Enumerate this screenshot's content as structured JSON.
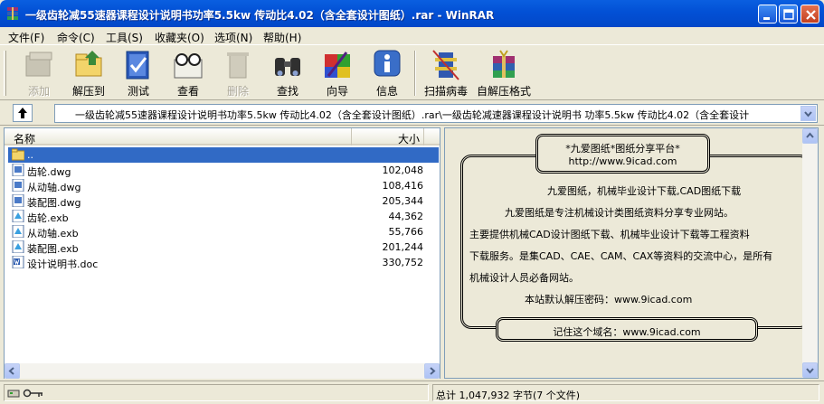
{
  "window": {
    "title": "一级齿轮减55速器课程设计说明书功率5.5kw 传动比4.02（含全套设计图纸）.rar - WinRAR"
  },
  "menu": [
    "文件(F)",
    "命令(C)",
    "工具(S)",
    "收藏夹(O)",
    "选项(N)",
    "帮助(H)"
  ],
  "toolbar": {
    "add": "添加",
    "extract_to": "解压到",
    "test": "测试",
    "view": "查看",
    "delete": "删除",
    "find": "查找",
    "wizard": "向导",
    "info": "信息",
    "scan": "扫描病毒",
    "sfx": "自解压格式"
  },
  "address": {
    "path": "一级齿轮减55速器课程设计说明书功率5.5kw 传动比4.02（含全套设计图纸）.rar\\一级齿轮减速器课程设计说明书 功率5.5kw 传动比4.02（含全套设计"
  },
  "columns": {
    "name": "名称",
    "size": "大小"
  },
  "files": [
    {
      "name": "..",
      "size": ""
    },
    {
      "name": "齿轮.dwg",
      "size": "102,048"
    },
    {
      "name": "从动轴.dwg",
      "size": "108,416"
    },
    {
      "name": "装配图.dwg",
      "size": "205,344"
    },
    {
      "name": "齿轮.exb",
      "size": "44,362"
    },
    {
      "name": "从动轴.exb",
      "size": "55,766"
    },
    {
      "name": "装配图.exb",
      "size": "201,244"
    },
    {
      "name": "设计说明书.doc",
      "size": "330,752"
    }
  ],
  "comment": {
    "header_title": "*九爱图纸*图纸分享平台*",
    "header_url": "http://www.9icad.com",
    "line1": "九爱图纸，机械毕业设计下载,CAD图纸下载",
    "line2": "九爱图纸是专注机械设计类图纸资料分享专业网站。",
    "line3": "主要提供机械CAD设计图纸下载、机械毕业设计下载等工程资料",
    "line4": "下载服务。是集CAD、CAE、CAM、CAX等资料的交流中心，是所有",
    "line5": "机械设计人员必备网站。",
    "line6": "本站默认解压密码：www.9icad.com",
    "footer": "记住这个域名：www.9icad.com"
  },
  "status": {
    "total": "总计 1,047,932 字节(7 个文件)"
  }
}
